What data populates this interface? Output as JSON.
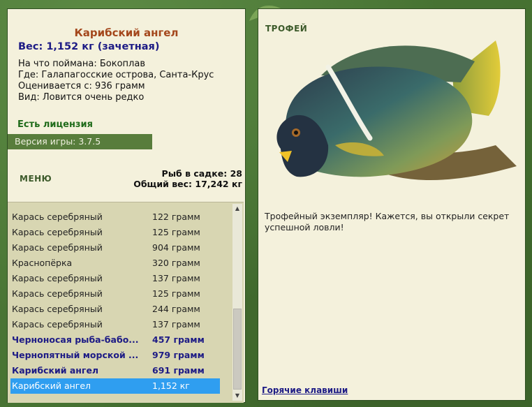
{
  "fish": {
    "name": "Карибский ангел",
    "weight_line": "Вес: 1,152 кг (зачетная)",
    "bait": "На что поймана: Бокоплав",
    "location": "Где: Галапагосские острова, Санта-Крус",
    "valued_from": "Оценивается с: 936 грамм",
    "rarity": "Вид: Ловится очень редко"
  },
  "license": "Есть лицензия",
  "version": "Версия игры: 3.7.5",
  "menu_label": "МЕНЮ",
  "stats": {
    "count": "Рыб в садке: 28",
    "total": "Общий вес: 17,242 кг"
  },
  "catch_list": [
    {
      "name": "Карась серебряный",
      "weight": "122 грамм"
    },
    {
      "name": "Карась серебряный",
      "weight": "125 грамм"
    },
    {
      "name": "Карась серебряный",
      "weight": "904 грамм"
    },
    {
      "name": "Краснопёрка",
      "weight": "320 грамм"
    },
    {
      "name": "Карась серебряный",
      "weight": "137 грамм"
    },
    {
      "name": "Карась серебряный",
      "weight": "125 грамм"
    },
    {
      "name": "Карась серебряный",
      "weight": "244 грамм"
    },
    {
      "name": "Карась серебряный",
      "weight": "137 грамм"
    },
    {
      "name": "Черноносая рыба-бабо...",
      "weight": "457 грамм"
    },
    {
      "name": "Чернопятный морской ...",
      "weight": "979 грамм"
    },
    {
      "name": "Карибский ангел",
      "weight": "691 грамм"
    },
    {
      "name": "Карибский ангел",
      "weight": "1,152 кг"
    }
  ],
  "trophy": {
    "label": "ТРОФЕЙ",
    "text": "Трофейный экземпляр! Кажется, вы открыли секрет успешной ловли!"
  },
  "hotkeys": "Горячие клавиши",
  "colors": {
    "background": "#466d32",
    "panel": "#f4f1dc",
    "title": "#a4471c",
    "weight": "#1d1b85",
    "license": "#1f6b1a",
    "selection": "#2f9ef0"
  }
}
